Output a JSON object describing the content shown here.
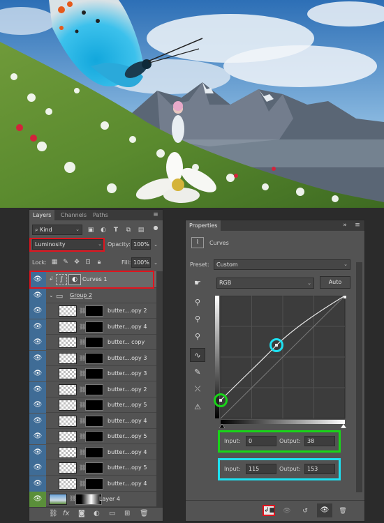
{
  "layers_panel": {
    "tabs": [
      "Layers",
      "Channels",
      "Paths"
    ],
    "filter_kind": "Kind",
    "blend_mode": "Luminosity",
    "opacity_label": "Opacity:",
    "opacity_value": "100%",
    "lock_label": "Lock:",
    "fill_label": "Fill:",
    "fill_value": "100%",
    "adjustment_layer": "Curves 1",
    "group_name": "Group 2",
    "layers": [
      "butter....opy 2",
      "butter....opy 4",
      "butter... copy",
      "butter....opy 3",
      "butter....opy 3",
      "butter....opy 2",
      "butter....opy 5",
      "butter....opy 4",
      "butter....opy 5",
      "butter....opy 4",
      "butter....opy 5",
      "butter....opy 4"
    ],
    "bottom_layer": "Layer 4"
  },
  "properties_panel": {
    "title": "Properties",
    "adjustment_name": "Curves",
    "preset_label": "Preset:",
    "preset_value": "Custom",
    "channel": "RGB",
    "auto_label": "Auto",
    "points": [
      {
        "input_label": "Input:",
        "input": "0",
        "output_label": "Output:",
        "output": "38"
      },
      {
        "input_label": "Input:",
        "input": "115",
        "output_label": "Output:",
        "output": "153"
      }
    ]
  },
  "highlight_colors": {
    "red": "#e0141e",
    "green": "#19d419",
    "cyan": "#1ee0f0",
    "selection_blue": "#3f6c96"
  },
  "icons": [
    "eye-icon",
    "folder-icon",
    "link-icon",
    "curves-icon",
    "eyedropper-icon",
    "pencil-icon",
    "clip-to-layer-icon",
    "reset-icon",
    "visibility-icon",
    "trash-icon",
    "fx-icon",
    "mask-icon",
    "new-layer-icon"
  ]
}
